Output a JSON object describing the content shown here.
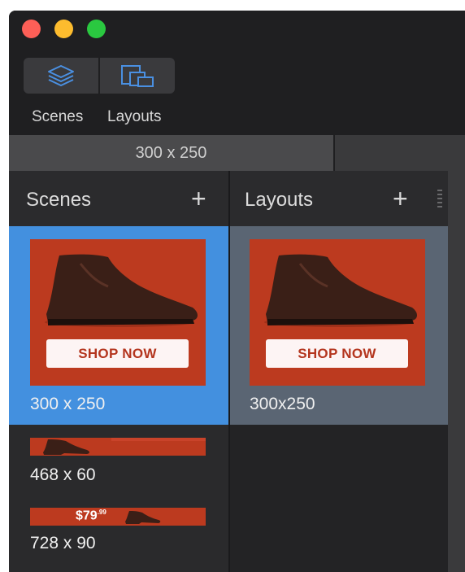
{
  "toolbar": {
    "scenes_label": "Scenes",
    "layouts_label": "Layouts",
    "scenes_icon": "layers-icon",
    "layouts_icon": "layouts-icon"
  },
  "tabs": [
    {
      "label": "300 x 250"
    }
  ],
  "scenes_panel": {
    "title": "Scenes",
    "add_icon": "+",
    "items": [
      {
        "label": "300 x 250",
        "button": "SHOP NOW"
      },
      {
        "label": "468 x 60"
      },
      {
        "label": "728 x 90",
        "price": "$79",
        "price_cents": ".99"
      }
    ]
  },
  "layouts_panel": {
    "title": "Layouts",
    "add_icon": "+",
    "items": [
      {
        "label": "300x250",
        "button": "SHOP NOW"
      }
    ]
  },
  "colors": {
    "accent": "#4390df",
    "ad_background": "#bc3a1f",
    "window_background": "#1e1e20"
  }
}
